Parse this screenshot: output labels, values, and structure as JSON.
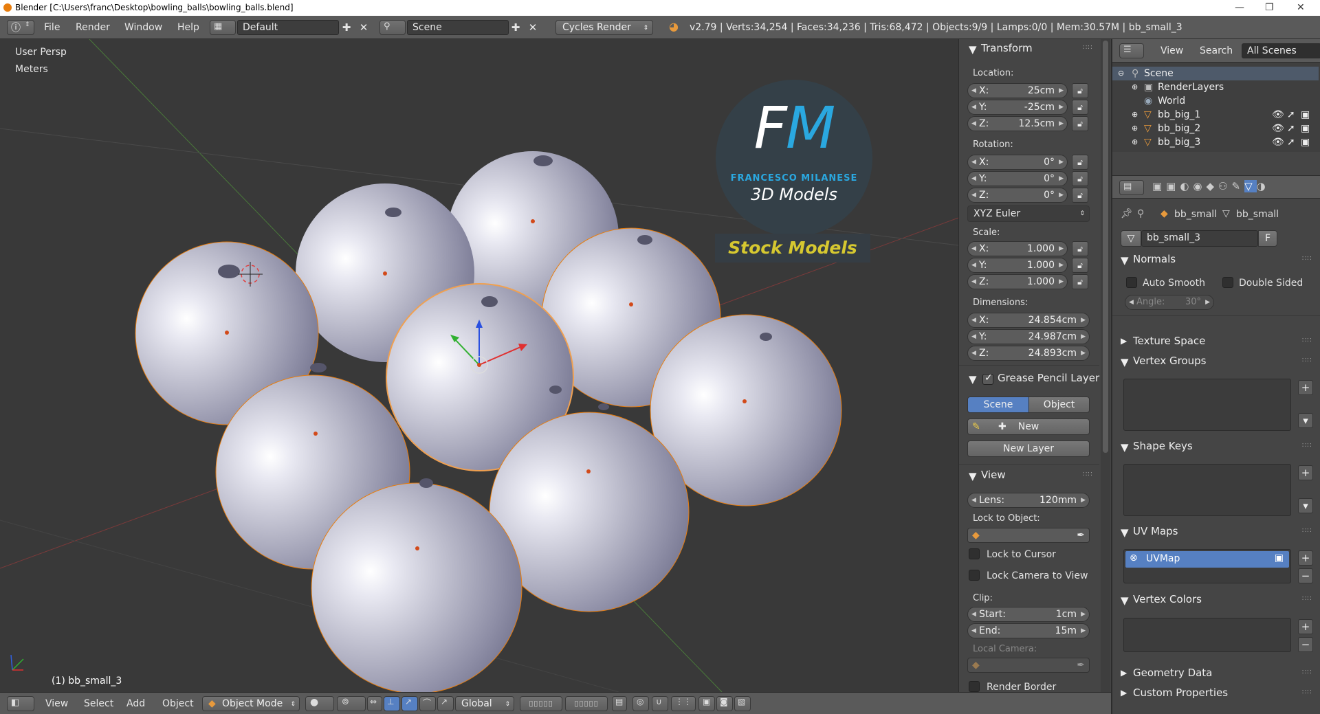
{
  "window": {
    "title": "Blender [C:\\Users\\franc\\Desktop\\bowling_balls\\bowling_balls.blend]"
  },
  "topbar": {
    "menus": [
      "File",
      "Render",
      "Window",
      "Help"
    ],
    "layout": "Default",
    "scene": "Scene",
    "engine": "Cycles Render",
    "info": "v2.79 | Verts:34,254 | Faces:34,236 | Tris:68,472 | Objects:9/9 | Lamps:0/0 | Mem:30.57M | bb_small_3"
  },
  "viewport": {
    "view_name": "User Persp",
    "units": "Meters",
    "object_label": "(1) bb_small_3",
    "logo": {
      "letters": "FM",
      "brand": "FRANCESCO MILANESE",
      "tag": "3D Models",
      "banner": "Stock Models"
    }
  },
  "transform": {
    "title": "Transform",
    "location_label": "Location:",
    "location": {
      "x": "25cm",
      "y": "-25cm",
      "z": "12.5cm"
    },
    "rotation_label": "Rotation:",
    "rotation": {
      "x": "0°",
      "y": "0°",
      "z": "0°"
    },
    "rotation_mode": "XYZ Euler",
    "scale_label": "Scale:",
    "scale": {
      "x": "1.000",
      "y": "1.000",
      "z": "1.000"
    },
    "dimensions_label": "Dimensions:",
    "dimensions": {
      "x": "24.854cm",
      "y": "24.987cm",
      "z": "24.893cm"
    },
    "axis": {
      "x": "X:",
      "y": "Y:",
      "z": "Z:"
    }
  },
  "grease": {
    "title": "Grease Pencil Layer",
    "tab_scene": "Scene",
    "tab_object": "Object",
    "new": "New",
    "new_layer": "New Layer"
  },
  "view": {
    "title": "View",
    "lens_label": "Lens:",
    "lens": "120mm",
    "lock_to_object": "Lock to Object:",
    "lock_to_cursor": "Lock to Cursor",
    "lock_camera": "Lock Camera to View",
    "clip_label": "Clip:",
    "clip_start_label": "Start:",
    "clip_start": "1cm",
    "clip_end_label": "End:",
    "clip_end": "15m",
    "local_camera": "Local Camera:",
    "render_border": "Render Border"
  },
  "outliner": {
    "menu_view": "View",
    "menu_search": "Search",
    "filter": "All Scenes",
    "items": [
      "Scene",
      "RenderLayers",
      "World",
      "bb_big_1",
      "bb_big_2",
      "bb_big_3"
    ]
  },
  "properties": {
    "breadcrumb_object": "bb_small",
    "breadcrumb_mesh": "bb_small",
    "mesh_name": "bb_small_3",
    "fake_user": "F",
    "normals": "Normals",
    "auto_smooth": "Auto Smooth",
    "double_sided": "Double Sided",
    "angle_label": "Angle:",
    "angle": "30°",
    "texture_space": "Texture Space",
    "vertex_groups": "Vertex Groups",
    "shape_keys": "Shape Keys",
    "uv_maps": "UV Maps",
    "uv_map_name": "UVMap",
    "vertex_colors": "Vertex Colors",
    "geometry_data": "Geometry Data",
    "custom_properties": "Custom Properties"
  },
  "bottombar": {
    "menus": [
      "View",
      "Select",
      "Add",
      "Object"
    ],
    "mode": "Object Mode",
    "orientation": "Global"
  },
  "colors": {
    "accent_blue": "#5680c2",
    "selection_orange": "#e87d0d",
    "viewport_bg": "#393939",
    "logo_text": "#d6c830",
    "logo_circle": "#344048"
  }
}
